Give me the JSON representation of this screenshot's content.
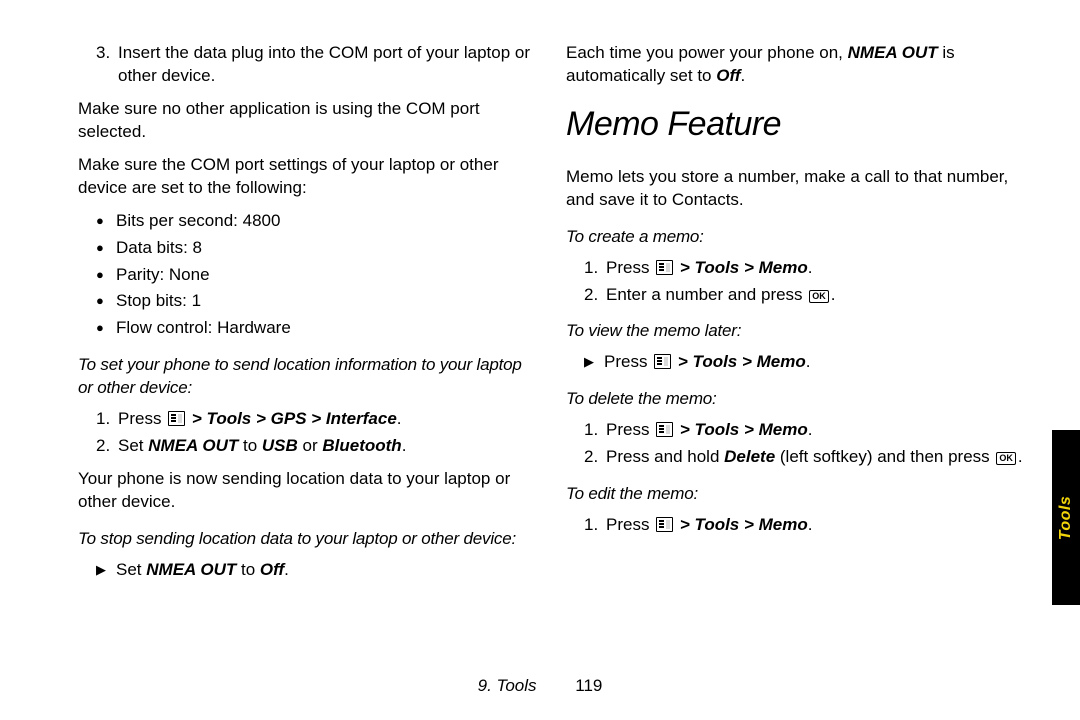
{
  "left": {
    "step3_num": "3.",
    "step3_text": "Insert the data plug into the COM port of your laptop or other device.",
    "p1": "Make sure no other application is using the COM port selected.",
    "p2": "Make sure the COM port settings of your laptop or other device are set to the following:",
    "settings": {
      "b1": "Bits per second: 4800",
      "b2": "Data bits: 8",
      "b3": "Parity: None",
      "b4": "Stop bits: 1",
      "b5": "Flow control: Hardware"
    },
    "sub1": "To set your phone to send location information to your laptop or other device:",
    "s1_num": "1.",
    "s1_a": "Press ",
    "s1_b": " > Tools > GPS > Interface",
    "s1_c": ".",
    "s2_num": "2.",
    "s2_a": "Set ",
    "s2_b": "NMEA OUT",
    "s2_c": " to ",
    "s2_d": "USB",
    "s2_e": " or ",
    "s2_f": "Bluetooth",
    "s2_g": ".",
    "p3": "Your phone is now sending location data to your laptop or other device.",
    "sub2": "To stop sending location data to your laptop or other device:",
    "stop_a": "Set ",
    "stop_b": "NMEA OUT",
    "stop_c": " to ",
    "stop_d": "Off",
    "stop_e": "."
  },
  "right": {
    "p1_a": "Each time you power your phone on, ",
    "p1_b": "NMEA OUT",
    "p1_c": " is automatically set to ",
    "p1_d": "Off",
    "p1_e": ".",
    "h2": "Memo Feature",
    "p2": "Memo lets you store a number, make a call to that number, and save it to Contacts.",
    "sub_create": "To create a memo:",
    "c1_num": "1.",
    "c1_a": "Press ",
    "c1_b": " > Tools > Memo",
    "c1_c": ".",
    "c2_num": "2.",
    "c2_a": "Enter a number and press ",
    "c2_b": ".",
    "sub_view": "To view the memo later:",
    "v_a": "Press ",
    "v_b": " > Tools > Memo",
    "v_c": ".",
    "sub_delete": "To delete the memo:",
    "d1_num": "1.",
    "d1_a": "Press ",
    "d1_b": " > Tools > Memo",
    "d1_c": ".",
    "d2_num": "2.",
    "d2_a": "Press and hold ",
    "d2_b": "Delete",
    "d2_c": " (left softkey) and then press ",
    "d2_d": ".",
    "sub_edit": "To edit the memo:",
    "e1_num": "1.",
    "e1_a": "Press ",
    "e1_b": " > Tools > Memo",
    "e1_c": "."
  },
  "footer": {
    "chapter": "9. Tools",
    "page": "119"
  },
  "sidetab": "Tools",
  "ok_label": "OK"
}
